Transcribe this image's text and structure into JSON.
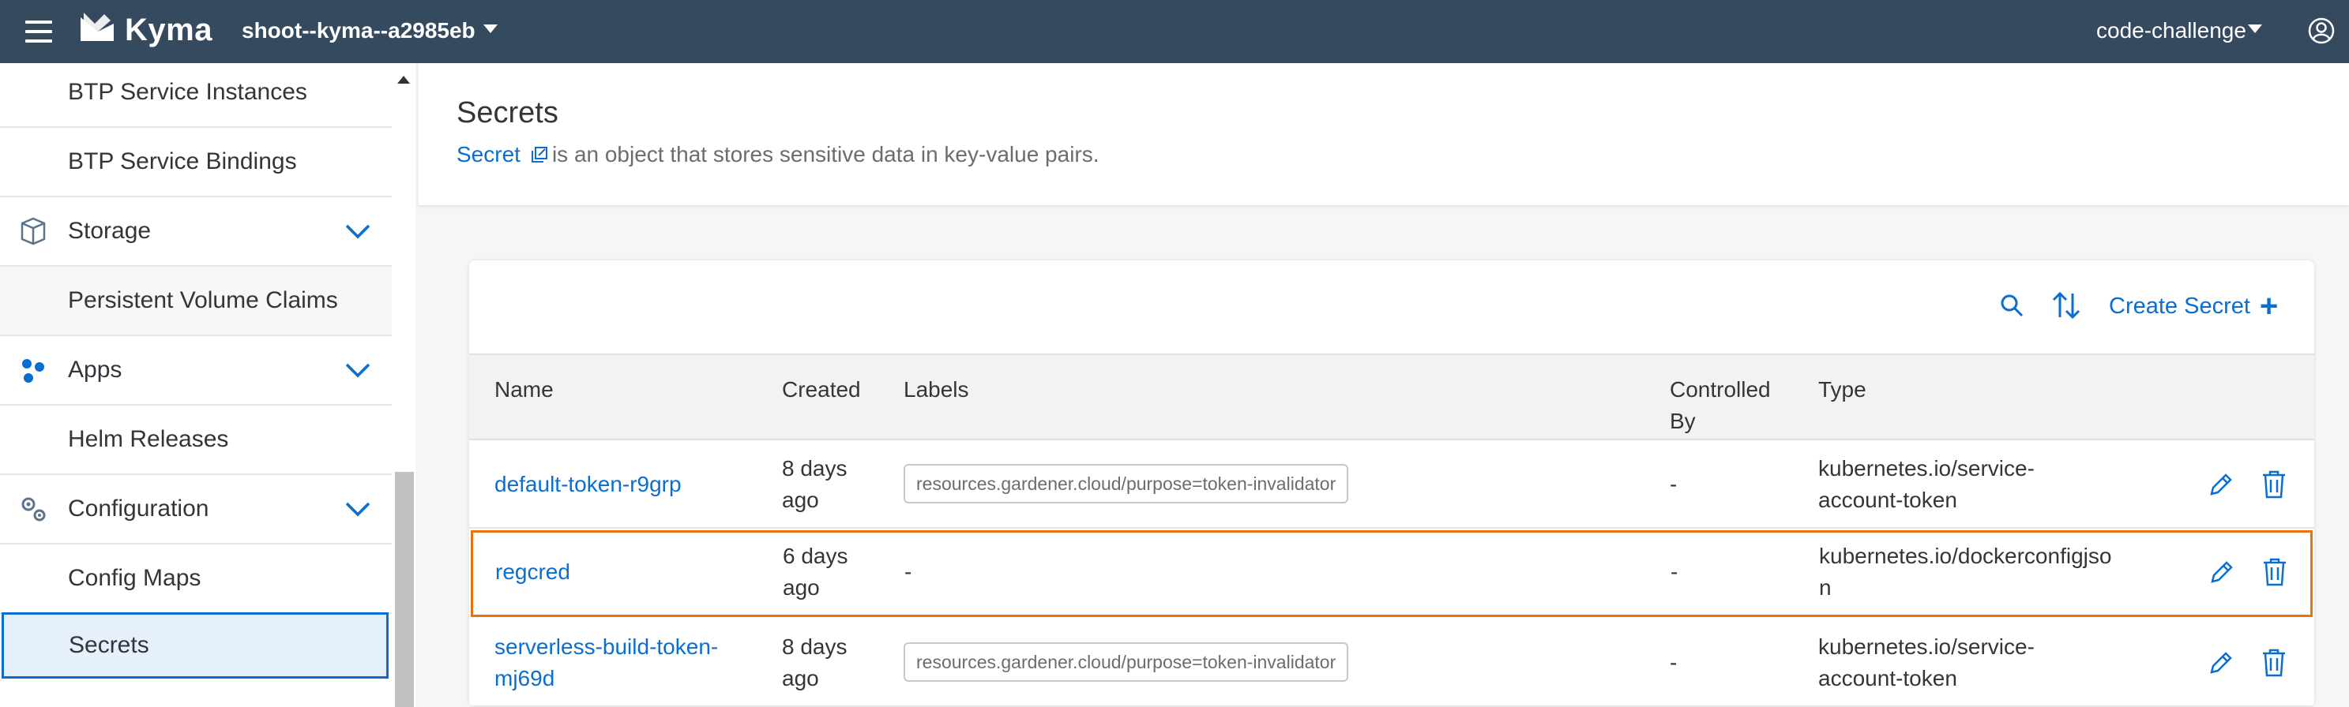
{
  "shell": {
    "brand": "Kyma",
    "cluster": "shoot--kyma--a2985eb",
    "namespace": "code-challenge"
  },
  "sidebar": {
    "items": [
      {
        "label": "BTP Service Instances"
      },
      {
        "label": "BTP Service Bindings"
      },
      {
        "label": "Storage"
      },
      {
        "label": "Persistent Volume Claims"
      },
      {
        "label": "Apps"
      },
      {
        "label": "Helm Releases"
      },
      {
        "label": "Configuration"
      },
      {
        "label": "Config Maps"
      },
      {
        "label": "Secrets"
      }
    ]
  },
  "page": {
    "title": "Secrets",
    "desc_link": "Secret",
    "desc_text": "is an object that stores sensitive data in key-value pairs."
  },
  "toolbar": {
    "create_label": "Create Secret"
  },
  "table": {
    "headers": {
      "name": "Name",
      "created": "Created",
      "labels": "Labels",
      "controlled_line1": "Controlled",
      "controlled_line2": "By",
      "type": "Type"
    },
    "rows": [
      {
        "name": "default-token-r9grp",
        "created_l1": "8 days",
        "created_l2": "ago",
        "label": "resources.gardener.cloud/purpose=token-invalidator",
        "controlled": "-",
        "type_l1": "kubernetes.io/service-",
        "type_l2": "account-token"
      },
      {
        "name": "regcred",
        "created_l1": "6 days",
        "created_l2": "ago",
        "label": "-",
        "controlled": "-",
        "type_l1": "kubernetes.io/dockerconfigjso",
        "type_l2": "n"
      },
      {
        "name_l1": "serverless-build-token-",
        "name_l2": "mj69d",
        "created_l1": "8 days",
        "created_l2": "ago",
        "label": "resources.gardener.cloud/purpose=token-invalidator",
        "controlled": "-",
        "type_l1": "kubernetes.io/service-",
        "type_l2": "account-token"
      }
    ]
  }
}
